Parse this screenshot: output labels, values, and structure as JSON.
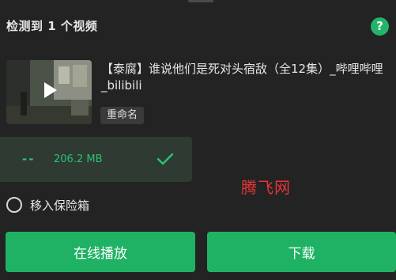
{
  "header": {
    "title": "检测到 1 个视频",
    "help_icon": "?"
  },
  "video": {
    "title": "【泰腐】谁说他们是死对头宿敌（全12集）_哔哩哔哩_bilibili",
    "rename_label": "重命名",
    "thumbnail_icon": "play-icon"
  },
  "format": {
    "resolution": "--",
    "size": "206.2 MB",
    "selected": true
  },
  "watermark": "腾飞网",
  "vault": {
    "label": "移入保险箱",
    "checked": false
  },
  "actions": {
    "play_label": "在线播放",
    "download_label": "下载"
  },
  "colors": {
    "accent": "#20b264",
    "background": "#232323",
    "card": "#2e3a32",
    "watermark": "#e83535"
  }
}
